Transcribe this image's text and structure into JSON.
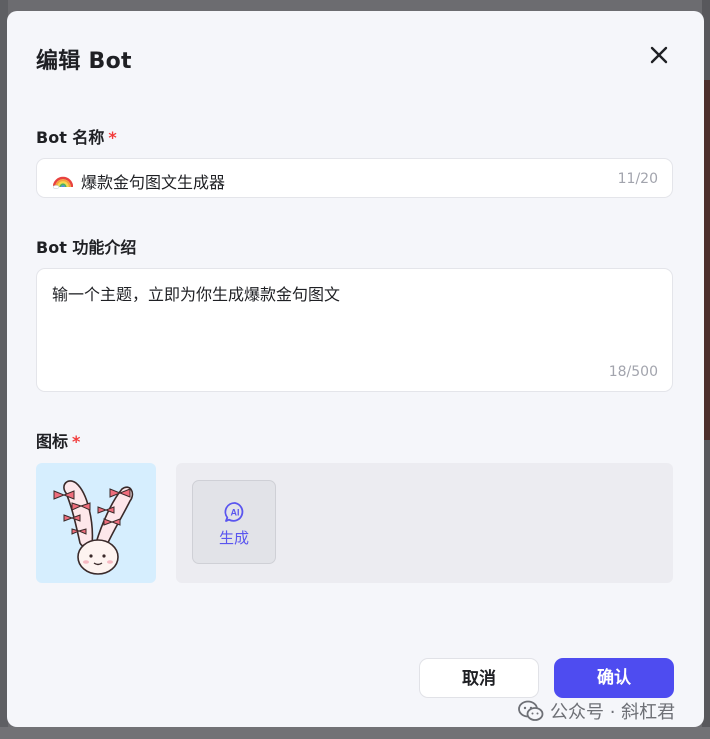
{
  "dialog": {
    "title": "编辑 Bot",
    "close_icon": "close-icon"
  },
  "name_field": {
    "label": "Bot 名称",
    "required_mark": "*",
    "emoji_icon": "rainbow-emoji-icon",
    "value": "爆款金句图文生成器",
    "counter": "11/20"
  },
  "desc_field": {
    "label": "Bot 功能介绍",
    "value": "输一个主题，立即为你生成爆款金句图文",
    "counter": "18/500"
  },
  "icon_field": {
    "label": "图标",
    "required_mark": "*",
    "preview_icon": "bunny-ears-avatar-icon",
    "generate_icon": "ai-chat-icon",
    "generate_label": "生成"
  },
  "footer": {
    "cancel_label": "取消",
    "confirm_label": "确认"
  },
  "watermark": {
    "logo_icon": "wechat-icon",
    "text": "公众号 · 斜杠君"
  },
  "colors": {
    "accent": "#4e4cf0",
    "required": "#f23b3b",
    "dialog_bg": "#f5f6fa",
    "preview_bg": "#d6eefe"
  }
}
